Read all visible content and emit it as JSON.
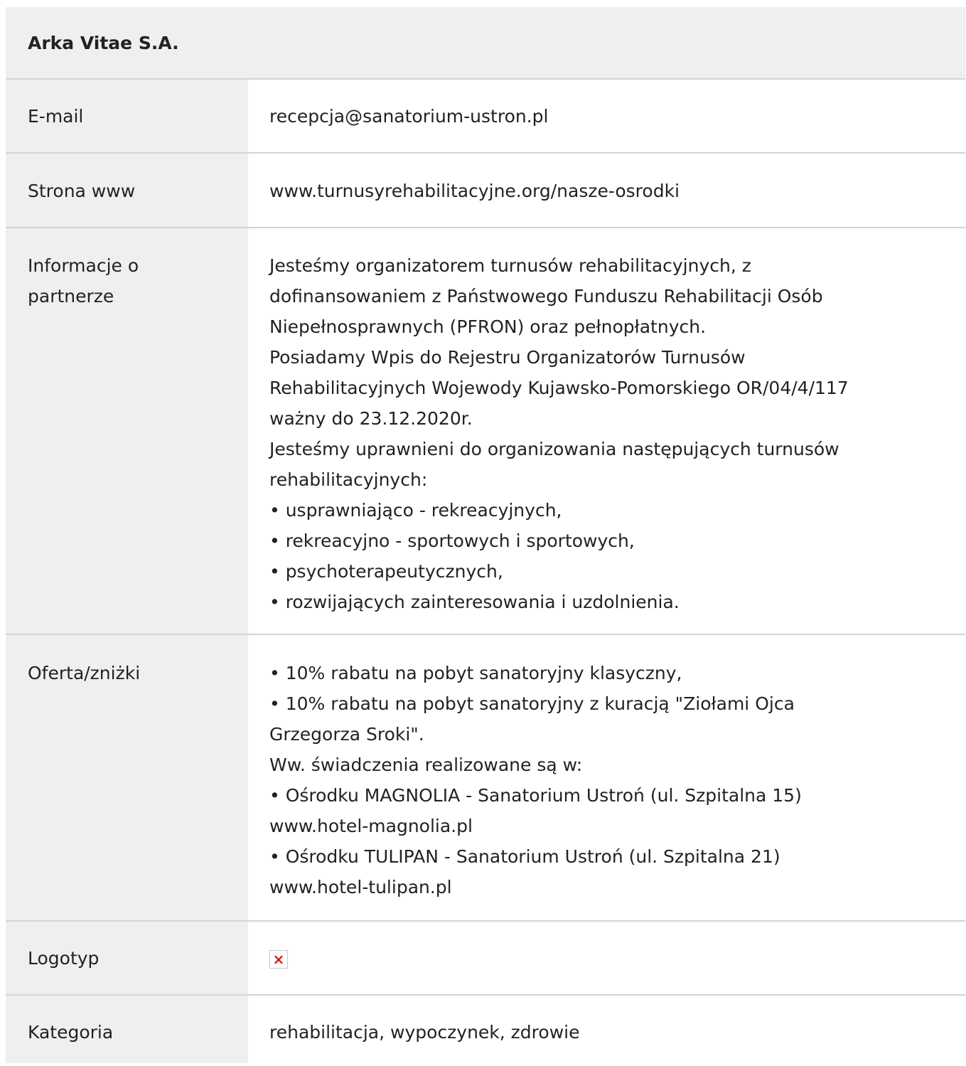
{
  "title": "Arka Vitae S.A.",
  "rows": {
    "email": {
      "label": "E-mail",
      "value": "recepcja@sanatorium-ustron.pl"
    },
    "website": {
      "label": "Strona www",
      "value": "www.turnusyrehabilitacyjne.org/nasze-osrodki"
    },
    "info": {
      "label_line1": "Informacje o",
      "label_line2": "partnerze",
      "lines": [
        "Jesteśmy organizatorem turnusów rehabilitacyjnych, z",
        "dofinansowaniem z Państwowego Funduszu Rehabilitacji Osób",
        "Niepełnosprawnych (PFRON) oraz pełnopłatnych.",
        "Posiadamy Wpis do Rejestru Organizatorów Turnusów",
        "Rehabilitacyjnych Wojewody Kujawsko-Pomorskiego OR/04/4/117",
        "ważny do 23.12.2020r.",
        "Jesteśmy uprawnieni do organizowania następujących turnusów",
        "rehabilitacyjnych:",
        "• usprawniająco - rekreacyjnych,",
        "• rekreacyjno - sportowych i sportowych,",
        "• psychoterapeutycznych,",
        "• rozwijających zainteresowania i uzdolnienia."
      ]
    },
    "offer": {
      "label": "Oferta/zniżki",
      "lines": [
        "• 10% rabatu na pobyt sanatoryjny klasyczny,",
        "• 10% rabatu na pobyt sanatoryjny z kuracją \"Ziołami Ojca",
        "Grzegorza Sroki\".",
        "Ww. świadczenia realizowane są w:",
        "• Ośrodku MAGNOLIA - Sanatorium Ustroń (ul. Szpitalna 15)",
        "www.hotel-magnolia.pl",
        "• Ośrodku TULIPAN - Sanatorium Ustroń (ul. Szpitalna 21)",
        "www.hotel-tulipan.pl"
      ]
    },
    "logo": {
      "label": "Logotyp",
      "icon": "broken-image-icon"
    },
    "category": {
      "label": "Kategoria",
      "value": "rehabilitacja, wypoczynek, zdrowie"
    }
  },
  "colors": {
    "label_bg": "#efefef",
    "border": "#d4d4d4",
    "text": "#222222",
    "broken_icon_x": "#cc1f1f"
  }
}
